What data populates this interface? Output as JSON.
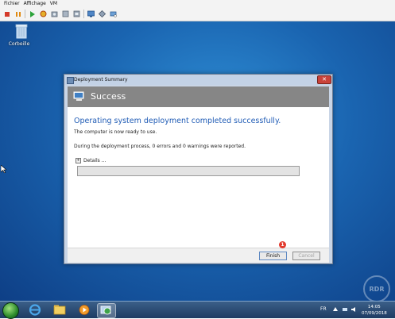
{
  "menubar": {
    "items": [
      "Fichier",
      "Affichage",
      "VM"
    ]
  },
  "toolbar": {
    "icons": [
      "stop-icon",
      "pause-icon",
      "play-icon",
      "reset-icon",
      "snapshot-icon",
      "revert-icon",
      "manage-snapshots-icon",
      "enhanced-session-icon",
      "share-icon",
      "settings-icon"
    ]
  },
  "desktop": {
    "recycle_bin_label": "Corbeille",
    "watermark_text": "RDR"
  },
  "dialog": {
    "title": "Deployment Summary",
    "banner": "Success",
    "heading": "Operating system deployment completed successfully.",
    "line1": "The computer is now ready to use.",
    "line2": "During the deployment process, 0 errors and 0 warnings were reported.",
    "details_label": "Details ...",
    "finish_label": "Finish",
    "cancel_label": "Cancel",
    "marker_number": "1",
    "close_glyph": "✕"
  },
  "taskbar": {
    "language": "FR",
    "time": "14:05",
    "date": "07/09/2018"
  },
  "colors": {
    "accent_heading": "#1f5bb5",
    "banner_bg": "#868686",
    "marker": "#e23a2e"
  }
}
